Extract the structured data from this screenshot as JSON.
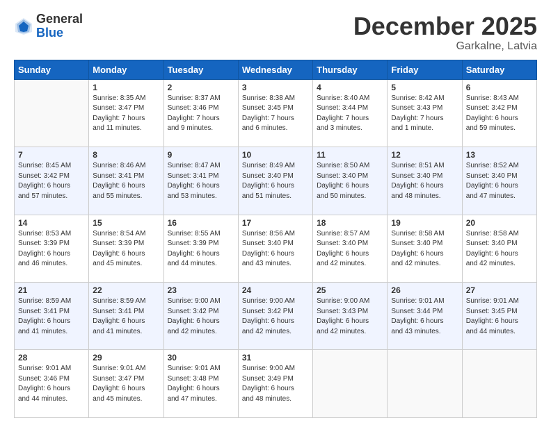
{
  "header": {
    "logo_general": "General",
    "logo_blue": "Blue",
    "month_title": "December 2025",
    "location": "Garkalne, Latvia"
  },
  "weekdays": [
    "Sunday",
    "Monday",
    "Tuesday",
    "Wednesday",
    "Thursday",
    "Friday",
    "Saturday"
  ],
  "weeks": [
    [
      {
        "day": "",
        "info": ""
      },
      {
        "day": "1",
        "info": "Sunrise: 8:35 AM\nSunset: 3:47 PM\nDaylight: 7 hours\nand 11 minutes."
      },
      {
        "day": "2",
        "info": "Sunrise: 8:37 AM\nSunset: 3:46 PM\nDaylight: 7 hours\nand 9 minutes."
      },
      {
        "day": "3",
        "info": "Sunrise: 8:38 AM\nSunset: 3:45 PM\nDaylight: 7 hours\nand 6 minutes."
      },
      {
        "day": "4",
        "info": "Sunrise: 8:40 AM\nSunset: 3:44 PM\nDaylight: 7 hours\nand 3 minutes."
      },
      {
        "day": "5",
        "info": "Sunrise: 8:42 AM\nSunset: 3:43 PM\nDaylight: 7 hours\nand 1 minute."
      },
      {
        "day": "6",
        "info": "Sunrise: 8:43 AM\nSunset: 3:42 PM\nDaylight: 6 hours\nand 59 minutes."
      }
    ],
    [
      {
        "day": "7",
        "info": "Sunrise: 8:45 AM\nSunset: 3:42 PM\nDaylight: 6 hours\nand 57 minutes."
      },
      {
        "day": "8",
        "info": "Sunrise: 8:46 AM\nSunset: 3:41 PM\nDaylight: 6 hours\nand 55 minutes."
      },
      {
        "day": "9",
        "info": "Sunrise: 8:47 AM\nSunset: 3:41 PM\nDaylight: 6 hours\nand 53 minutes."
      },
      {
        "day": "10",
        "info": "Sunrise: 8:49 AM\nSunset: 3:40 PM\nDaylight: 6 hours\nand 51 minutes."
      },
      {
        "day": "11",
        "info": "Sunrise: 8:50 AM\nSunset: 3:40 PM\nDaylight: 6 hours\nand 50 minutes."
      },
      {
        "day": "12",
        "info": "Sunrise: 8:51 AM\nSunset: 3:40 PM\nDaylight: 6 hours\nand 48 minutes."
      },
      {
        "day": "13",
        "info": "Sunrise: 8:52 AM\nSunset: 3:40 PM\nDaylight: 6 hours\nand 47 minutes."
      }
    ],
    [
      {
        "day": "14",
        "info": "Sunrise: 8:53 AM\nSunset: 3:39 PM\nDaylight: 6 hours\nand 46 minutes."
      },
      {
        "day": "15",
        "info": "Sunrise: 8:54 AM\nSunset: 3:39 PM\nDaylight: 6 hours\nand 45 minutes."
      },
      {
        "day": "16",
        "info": "Sunrise: 8:55 AM\nSunset: 3:39 PM\nDaylight: 6 hours\nand 44 minutes."
      },
      {
        "day": "17",
        "info": "Sunrise: 8:56 AM\nSunset: 3:40 PM\nDaylight: 6 hours\nand 43 minutes."
      },
      {
        "day": "18",
        "info": "Sunrise: 8:57 AM\nSunset: 3:40 PM\nDaylight: 6 hours\nand 42 minutes."
      },
      {
        "day": "19",
        "info": "Sunrise: 8:58 AM\nSunset: 3:40 PM\nDaylight: 6 hours\nand 42 minutes."
      },
      {
        "day": "20",
        "info": "Sunrise: 8:58 AM\nSunset: 3:40 PM\nDaylight: 6 hours\nand 42 minutes."
      }
    ],
    [
      {
        "day": "21",
        "info": "Sunrise: 8:59 AM\nSunset: 3:41 PM\nDaylight: 6 hours\nand 41 minutes."
      },
      {
        "day": "22",
        "info": "Sunrise: 8:59 AM\nSunset: 3:41 PM\nDaylight: 6 hours\nand 41 minutes."
      },
      {
        "day": "23",
        "info": "Sunrise: 9:00 AM\nSunset: 3:42 PM\nDaylight: 6 hours\nand 42 minutes."
      },
      {
        "day": "24",
        "info": "Sunrise: 9:00 AM\nSunset: 3:42 PM\nDaylight: 6 hours\nand 42 minutes."
      },
      {
        "day": "25",
        "info": "Sunrise: 9:00 AM\nSunset: 3:43 PM\nDaylight: 6 hours\nand 42 minutes."
      },
      {
        "day": "26",
        "info": "Sunrise: 9:01 AM\nSunset: 3:44 PM\nDaylight: 6 hours\nand 43 minutes."
      },
      {
        "day": "27",
        "info": "Sunrise: 9:01 AM\nSunset: 3:45 PM\nDaylight: 6 hours\nand 44 minutes."
      }
    ],
    [
      {
        "day": "28",
        "info": "Sunrise: 9:01 AM\nSunset: 3:46 PM\nDaylight: 6 hours\nand 44 minutes."
      },
      {
        "day": "29",
        "info": "Sunrise: 9:01 AM\nSunset: 3:47 PM\nDaylight: 6 hours\nand 45 minutes."
      },
      {
        "day": "30",
        "info": "Sunrise: 9:01 AM\nSunset: 3:48 PM\nDaylight: 6 hours\nand 47 minutes."
      },
      {
        "day": "31",
        "info": "Sunrise: 9:00 AM\nSunset: 3:49 PM\nDaylight: 6 hours\nand 48 minutes."
      },
      {
        "day": "",
        "info": ""
      },
      {
        "day": "",
        "info": ""
      },
      {
        "day": "",
        "info": ""
      }
    ]
  ]
}
